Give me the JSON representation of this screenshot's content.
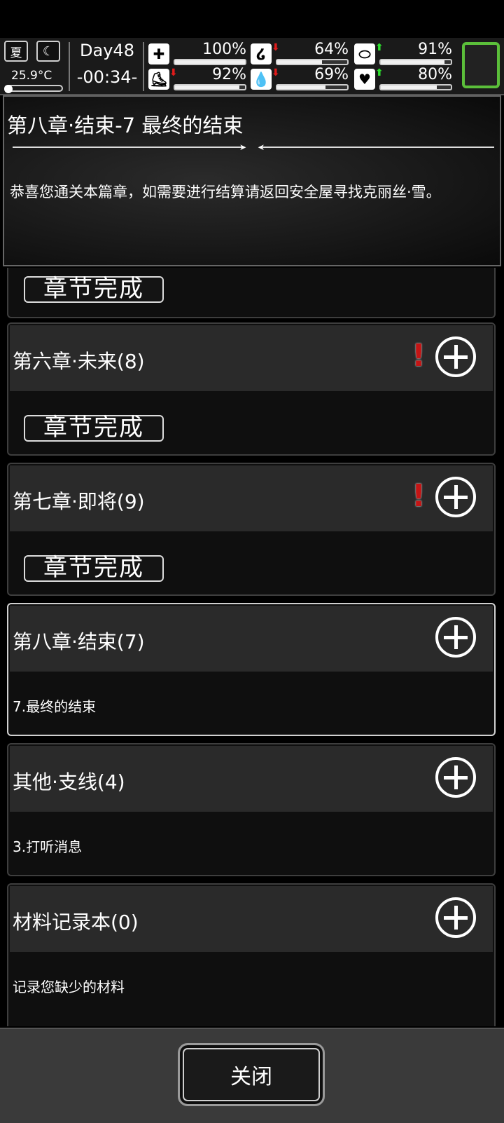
{
  "status": {
    "season": "夏",
    "moon_icon": "crescent-moon-icon",
    "temperature": "25.9°C",
    "day": "Day48",
    "clock": "-00:34-",
    "stats": [
      {
        "name": "health",
        "icon": "medkit-icon",
        "value": "100%",
        "level": 1.0,
        "trend": ""
      },
      {
        "name": "hunger",
        "icon": "stomach-icon",
        "value": "64%",
        "level": 0.64,
        "trend": "down"
      },
      {
        "name": "medicine",
        "icon": "pill-icon",
        "value": "91%",
        "level": 0.91,
        "trend": "up"
      },
      {
        "name": "stamina",
        "icon": "boot-icon",
        "value": "92%",
        "level": 0.92,
        "trend": "down"
      },
      {
        "name": "thirst",
        "icon": "water-drop-icon",
        "value": "69%",
        "level": 0.69,
        "trend": "down"
      },
      {
        "name": "mood",
        "icon": "heart-icon",
        "value": "80%",
        "level": 0.8,
        "trend": "up"
      }
    ],
    "trend_arrow": "⬇",
    "trend_arrow_up": "⬆"
  },
  "header": {
    "title": "第八章·结束-7 最终的结束",
    "description": "恭喜您通关本篇章，如需要进行结算请返回安全屋寻找克丽丝·雪。"
  },
  "chapters": [
    {
      "title": "",
      "stamp": "章节完成"
    },
    {
      "title": "第六章·未来(8)",
      "stamp": "章节完成",
      "alert": "!"
    },
    {
      "title": "第七章·即将(9)",
      "stamp": "章节完成",
      "alert": "!"
    },
    {
      "title": "第八章·结束(7)",
      "subtitle": "7.最终的结束"
    },
    {
      "title": "其他·支线(4)",
      "subtitle": "3.打听消息"
    },
    {
      "title": "材料记录本(0)",
      "subtitle": "记录您缺少的材料"
    }
  ],
  "footer": {
    "close_label": "关闭"
  }
}
